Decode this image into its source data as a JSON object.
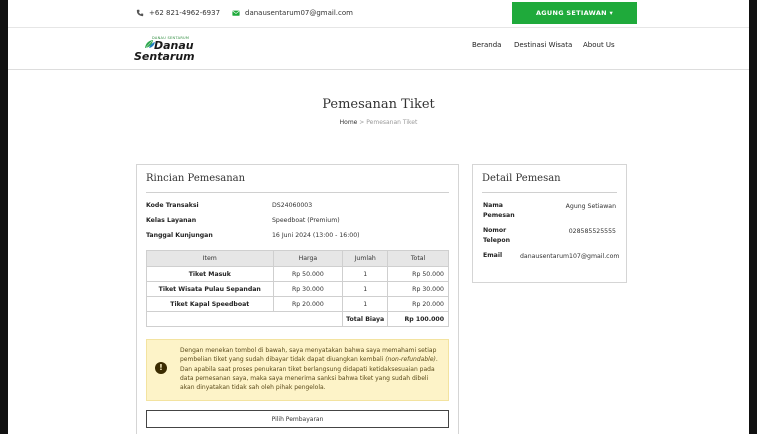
{
  "topbar": {
    "phone": "+62 821-4962-6937",
    "email": "danausentarum07@gmail.com",
    "user_button": "AGUNG SETIAWAN ▾"
  },
  "logo": {
    "tagline": "DANAU SENTARUM",
    "line1": "Danau",
    "line2": "Sentarum"
  },
  "nav": {
    "items": [
      "Beranda",
      "Destinasi Wisata",
      "About Us"
    ]
  },
  "hero": {
    "title": "Pemesanan Tiket",
    "breadcrumb_home": "Home",
    "breadcrumb_sep": ">",
    "breadcrumb_current": "Pemesanan Tiket"
  },
  "rincian": {
    "title": "Rincian Pemesanan",
    "fields": [
      {
        "label": "Kode Transaksi",
        "value": "DS24060003"
      },
      {
        "label": "Kelas Layanan",
        "value": "Speedboat (Premium)"
      },
      {
        "label": "Tanggal Kunjungan",
        "value": "16 Juni 2024 (13:00 - 16:00)"
      }
    ],
    "table": {
      "headers": [
        "Item",
        "Harga",
        "Jumlah",
        "Total"
      ],
      "rows": [
        {
          "item": "Tiket Masuk",
          "harga": "Rp 50.000",
          "jumlah": "1",
          "total": "Rp 50.000"
        },
        {
          "item": "Tiket Wisata Pulau Sepandan",
          "harga": "Rp 30.000",
          "jumlah": "1",
          "total": "Rp 30.000"
        },
        {
          "item": "Tiket Kapal Speedboat",
          "harga": "Rp 20.000",
          "jumlah": "1",
          "total": "Rp 20.000"
        }
      ],
      "total_label": "Total Biaya",
      "total_value": "Rp 100.000"
    },
    "warning": {
      "text_1": "Dengan menekan tombol di bawah, saya menyatakan bahwa saya memahami setiap pembelian tiket yang sudah dibayar tidak dapat diuangkan kembali ",
      "text_italic": "(non-refundable)",
      "text_2": ". Dan apabila saat proses penukaran tiket berlangsung didapati ketidaksesuaian pada data pemesanan saya, maka saya menerima sanksi bahwa tiket yang sudah dibeli akan dinyatakan tidak sah oleh pihak pengelola."
    },
    "pay_button": "Pilih Pembayaran"
  },
  "pemesan": {
    "title": "Detail Pemesan",
    "fields": [
      {
        "label": "Nama Pemesan",
        "value": "Agung Setiawan"
      },
      {
        "label": "Nomor Telepon",
        "value": "028585525555"
      },
      {
        "label": "Email",
        "value": "danausentarum107@gmail.com"
      }
    ]
  }
}
